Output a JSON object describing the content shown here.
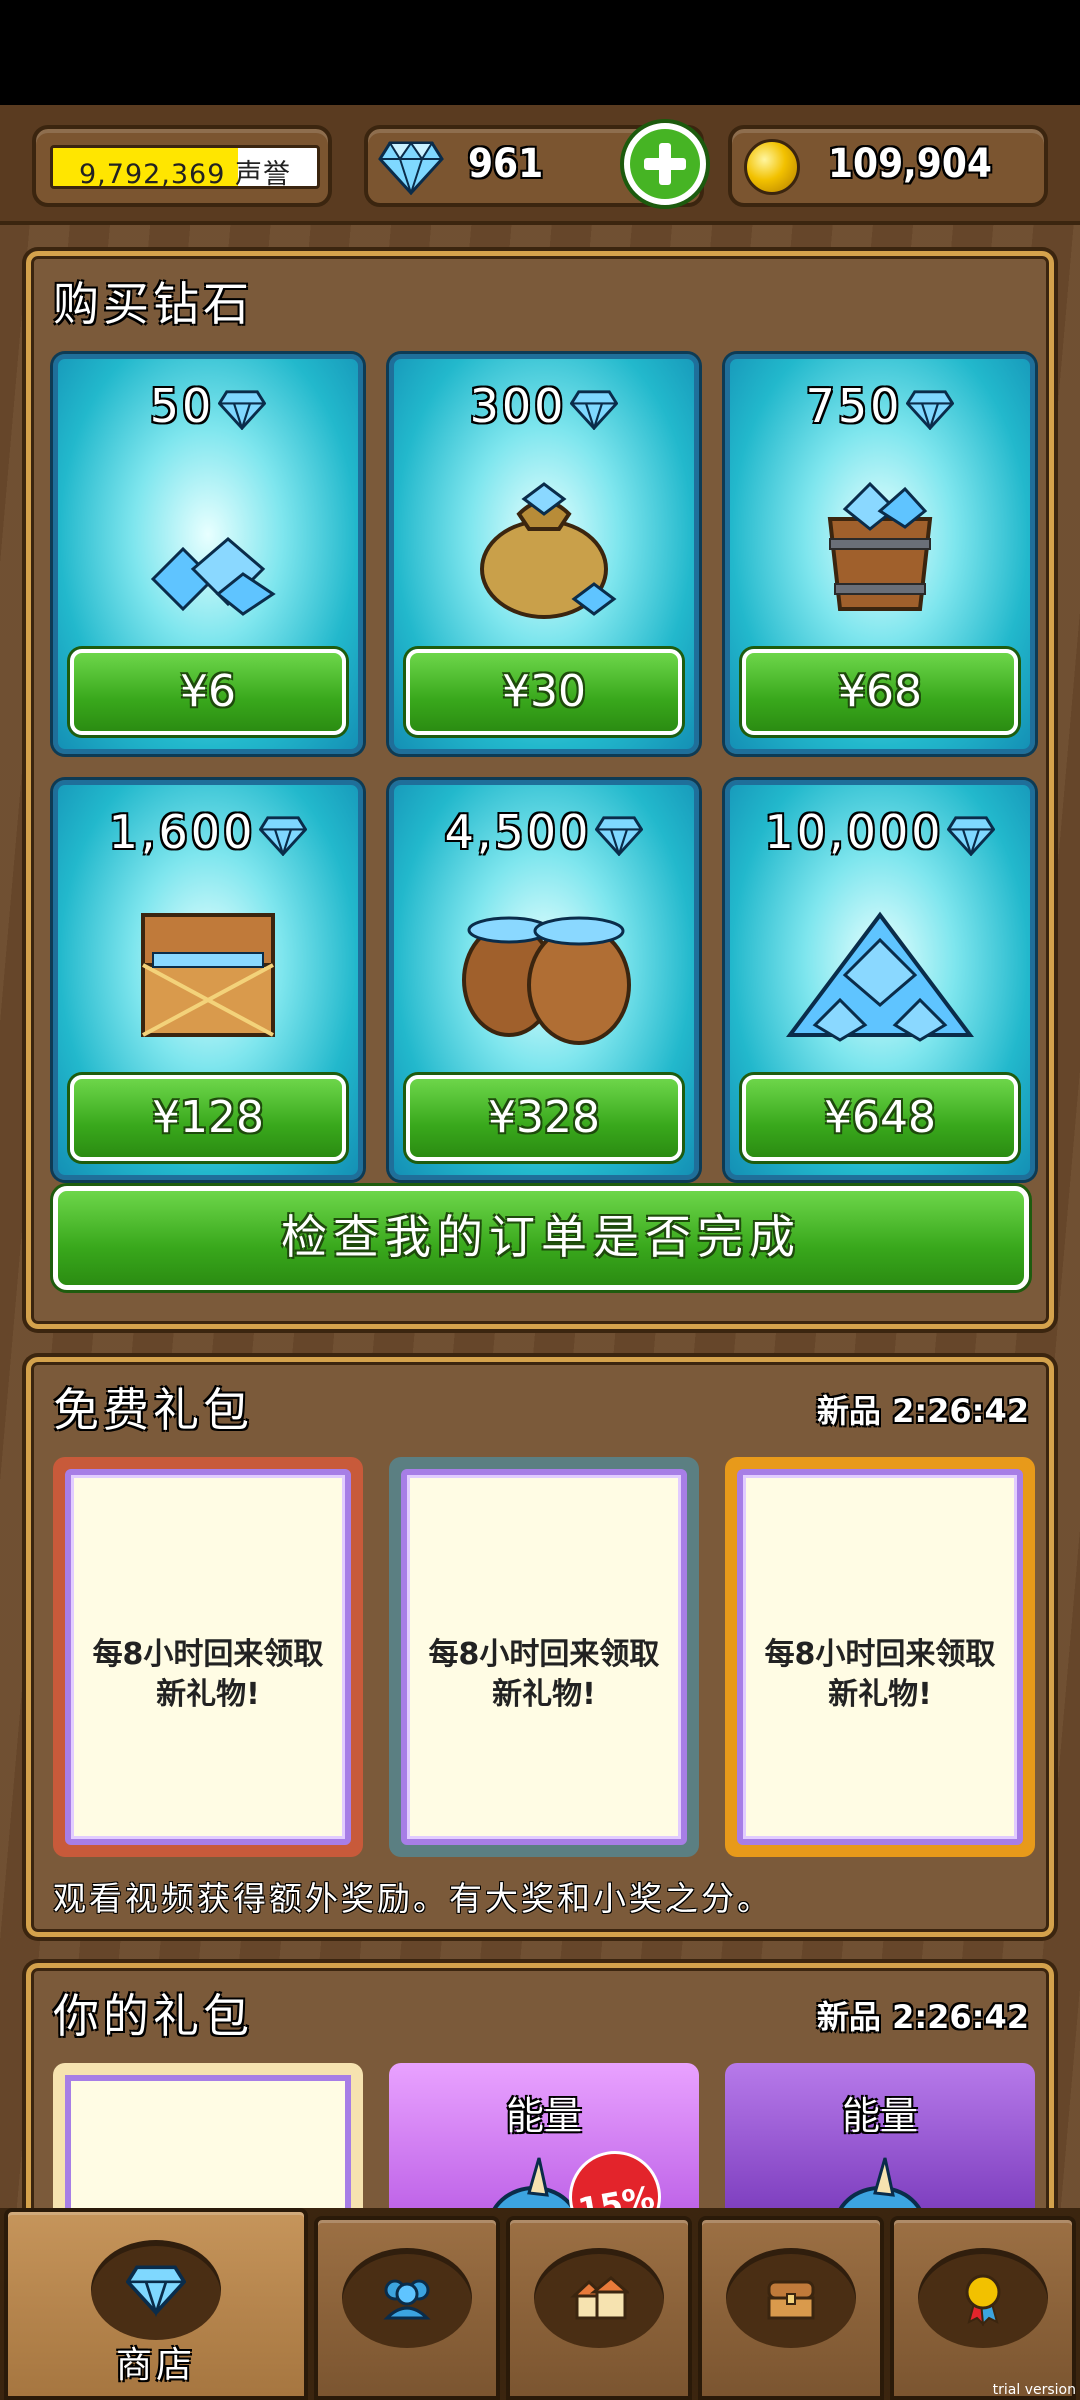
{
  "currency": {
    "reputation_text": "9,792,369 声誉",
    "reputation_fill": 0.7,
    "diamonds": "961",
    "gold": "109,904"
  },
  "buy_section": {
    "title": "购买钻石",
    "offers": [
      {
        "amount": "50",
        "price": "¥6",
        "art": "diamond-pile-small-icon"
      },
      {
        "amount": "300",
        "price": "¥30",
        "art": "diamond-sack-icon"
      },
      {
        "amount": "750",
        "price": "¥68",
        "art": "diamond-bucket-icon"
      },
      {
        "amount": "1,600",
        "price": "¥128",
        "art": "treasure-chest-icon"
      },
      {
        "amount": "4,500",
        "price": "¥328",
        "art": "diamond-barrels-icon"
      },
      {
        "amount": "10,000",
        "price": "¥648",
        "art": "diamond-mountain-icon"
      }
    ],
    "check_button": "检查我的订单是否完成"
  },
  "free_gifts": {
    "title": "免费礼包",
    "timer": "新品 2:26:42",
    "cards": [
      {
        "text": "每8小时回来领取新礼物!",
        "frame": "#c85a3a"
      },
      {
        "text": "每8小时回来领取新礼物!",
        "frame": "#5b7f82"
      },
      {
        "text": "每8小时回来领取新礼物!",
        "frame": "#e89a1a"
      }
    ],
    "note": "观看视频获得额外奖励。有大奖和小奖之分。"
  },
  "your_gifts": {
    "title": "你的礼包",
    "timer": "新品 2:26:42",
    "cards": [
      {
        "label": ""
      },
      {
        "label": "能量",
        "badge": "15%"
      },
      {
        "label": "能量"
      }
    ]
  },
  "nav": {
    "tabs": [
      {
        "label": "商店",
        "icon": "diamond-icon",
        "active": true
      },
      {
        "label": "",
        "icon": "group-icon",
        "active": false
      },
      {
        "label": "",
        "icon": "houses-icon",
        "active": false
      },
      {
        "label": "",
        "icon": "chest-icon",
        "active": false
      },
      {
        "label": "",
        "icon": "medal-icon",
        "active": false
      }
    ]
  },
  "watermark": "trial version",
  "colors": {
    "brand_green": "#39a81c",
    "panel_wood": "#7b5a3a",
    "offer_cyan": "#22b8cc"
  }
}
